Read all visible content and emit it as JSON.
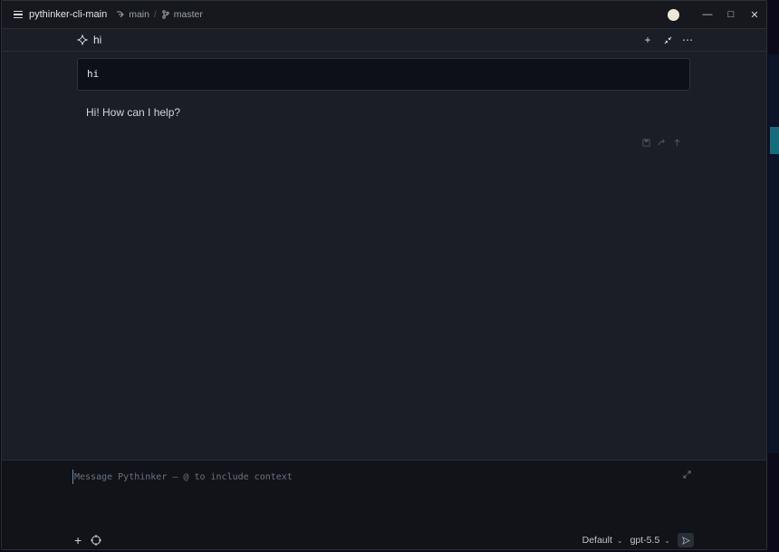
{
  "window": {
    "title": "pythinker-cli-main",
    "worktree": "main",
    "branch": "master"
  },
  "conversation": {
    "title": "hi",
    "user_message": "hi",
    "assistant_message": "Hi! How can I help?"
  },
  "composer": {
    "placeholder": "Message Pythinker — @ to include context",
    "mode": "Default",
    "model": "gpt-5.5"
  },
  "icons": {
    "menu": "menu-icon",
    "worktree": "worktree-icon",
    "branch": "git-branch-icon",
    "sparkle": "sparkle-icon",
    "add": "plus-icon",
    "collapse": "collapse-icon",
    "more": "ellipsis-icon",
    "save": "save-icon",
    "share": "share-icon",
    "up": "arrow-up-icon",
    "expand": "expand-icon",
    "target": "crosshair-icon",
    "send": "send-icon"
  },
  "colors": {
    "window_bg": "#1b1e24",
    "titlebar_bg": "#16181d",
    "message_bg": "#0d1117",
    "composer_bg": "#111318",
    "avatar": "#ece8d5"
  }
}
